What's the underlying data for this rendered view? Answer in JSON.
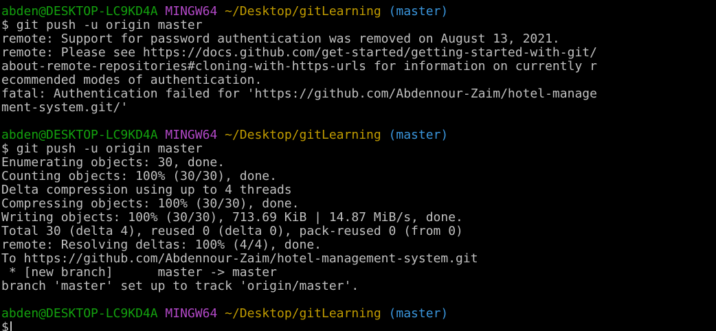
{
  "prompt": {
    "user_host": "abden@DESKTOP-LC9KD4A",
    "system": "MINGW64",
    "path": "~/Desktop/gitLearning",
    "branch": "(master)",
    "symbol": "$"
  },
  "session1": {
    "command": "git push -u origin master",
    "output": [
      "remote: Support for password authentication was removed on August 13, 2021.",
      "remote: Please see https://docs.github.com/get-started/getting-started-with-git/",
      "about-remote-repositories#cloning-with-https-urls for information on currently r",
      "ecommended modes of authentication.",
      "fatal: Authentication failed for 'https://github.com/Abdennour-Zaim/hotel-manage",
      "ment-system.git/'"
    ]
  },
  "session2": {
    "command": "git push -u origin master",
    "output": [
      "Enumerating objects: 30, done.",
      "Counting objects: 100% (30/30), done.",
      "Delta compression using up to 4 threads",
      "Compressing objects: 100% (30/30), done.",
      "Writing objects: 100% (30/30), 713.69 KiB | 14.87 MiB/s, done.",
      "Total 30 (delta 4), reused 0 (delta 0), pack-reused 0 (from 0)",
      "remote: Resolving deltas: 100% (4/4), done.",
      "To https://github.com/Abdennour-Zaim/hotel-management-system.git",
      " * [new branch]      master -> master",
      "branch 'master' set up to track 'origin/master'."
    ]
  },
  "colors": {
    "background": "#000000",
    "text": "#c0c0c0",
    "user_host": "#13a10e",
    "system": "#b148c6",
    "path": "#c19c00",
    "branch": "#3a96dd"
  }
}
